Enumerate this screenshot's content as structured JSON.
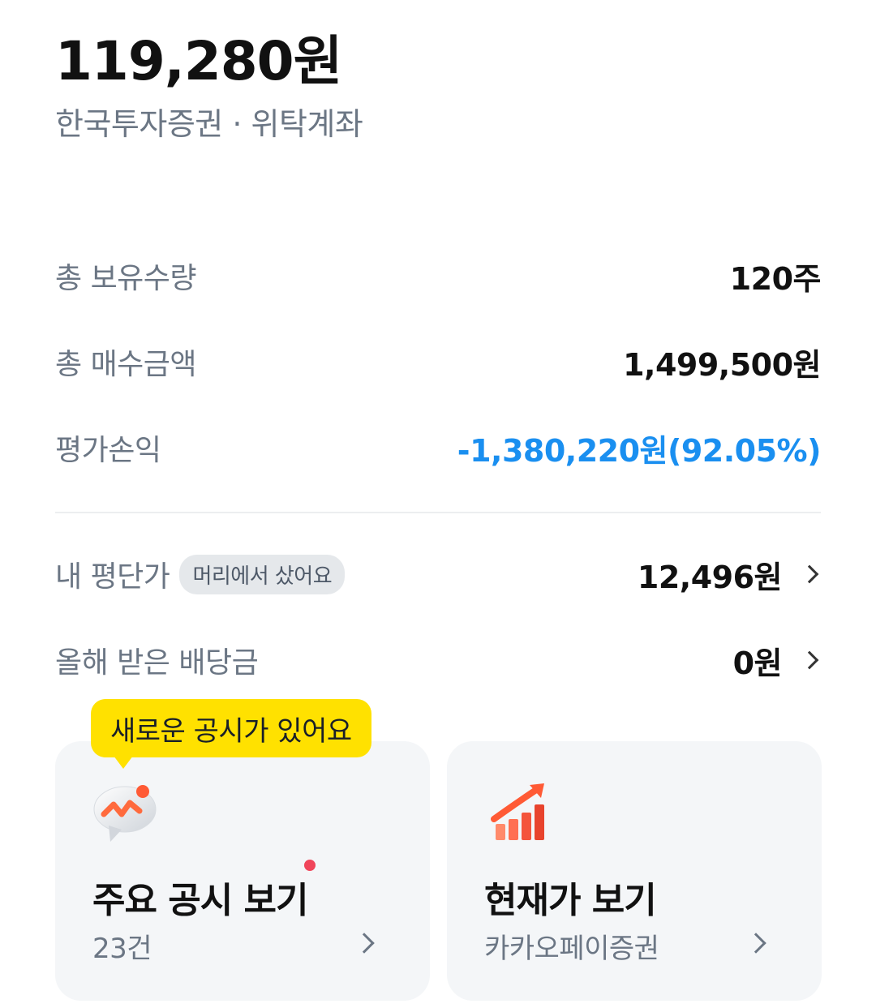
{
  "header": {
    "total_value": "119,280원",
    "account": "한국투자증권 · 위탁계좌"
  },
  "summary": [
    {
      "label": "총 보유수량",
      "value": "120주"
    },
    {
      "label": "총 매수금액",
      "value": "1,499,500원"
    },
    {
      "label": "평가손익",
      "value": "-1,380,220원(92.05%)"
    }
  ],
  "avg_price": {
    "label": "내 평단가",
    "badge": "머리에서 샀어요",
    "value": "12,496원"
  },
  "dividend": {
    "label": "올해 받은 배당금",
    "value": "0원"
  },
  "tooltip": {
    "text": "새로운 공시가 있어요"
  },
  "cards": {
    "disclosure": {
      "title": "주요 공시 보기",
      "sub": "23건",
      "icon": "chat-bubble-trend-icon"
    },
    "price": {
      "title": "현재가 보기",
      "sub": "카카오페이증권",
      "icon": "rising-bar-chart-icon"
    }
  },
  "colors": {
    "loss": "#1a8ff0",
    "badge_bg": "#e5e8eb",
    "tooltip_bg": "#ffe100",
    "card_bg": "#f4f6f8",
    "notification_dot": "#f0455a"
  }
}
